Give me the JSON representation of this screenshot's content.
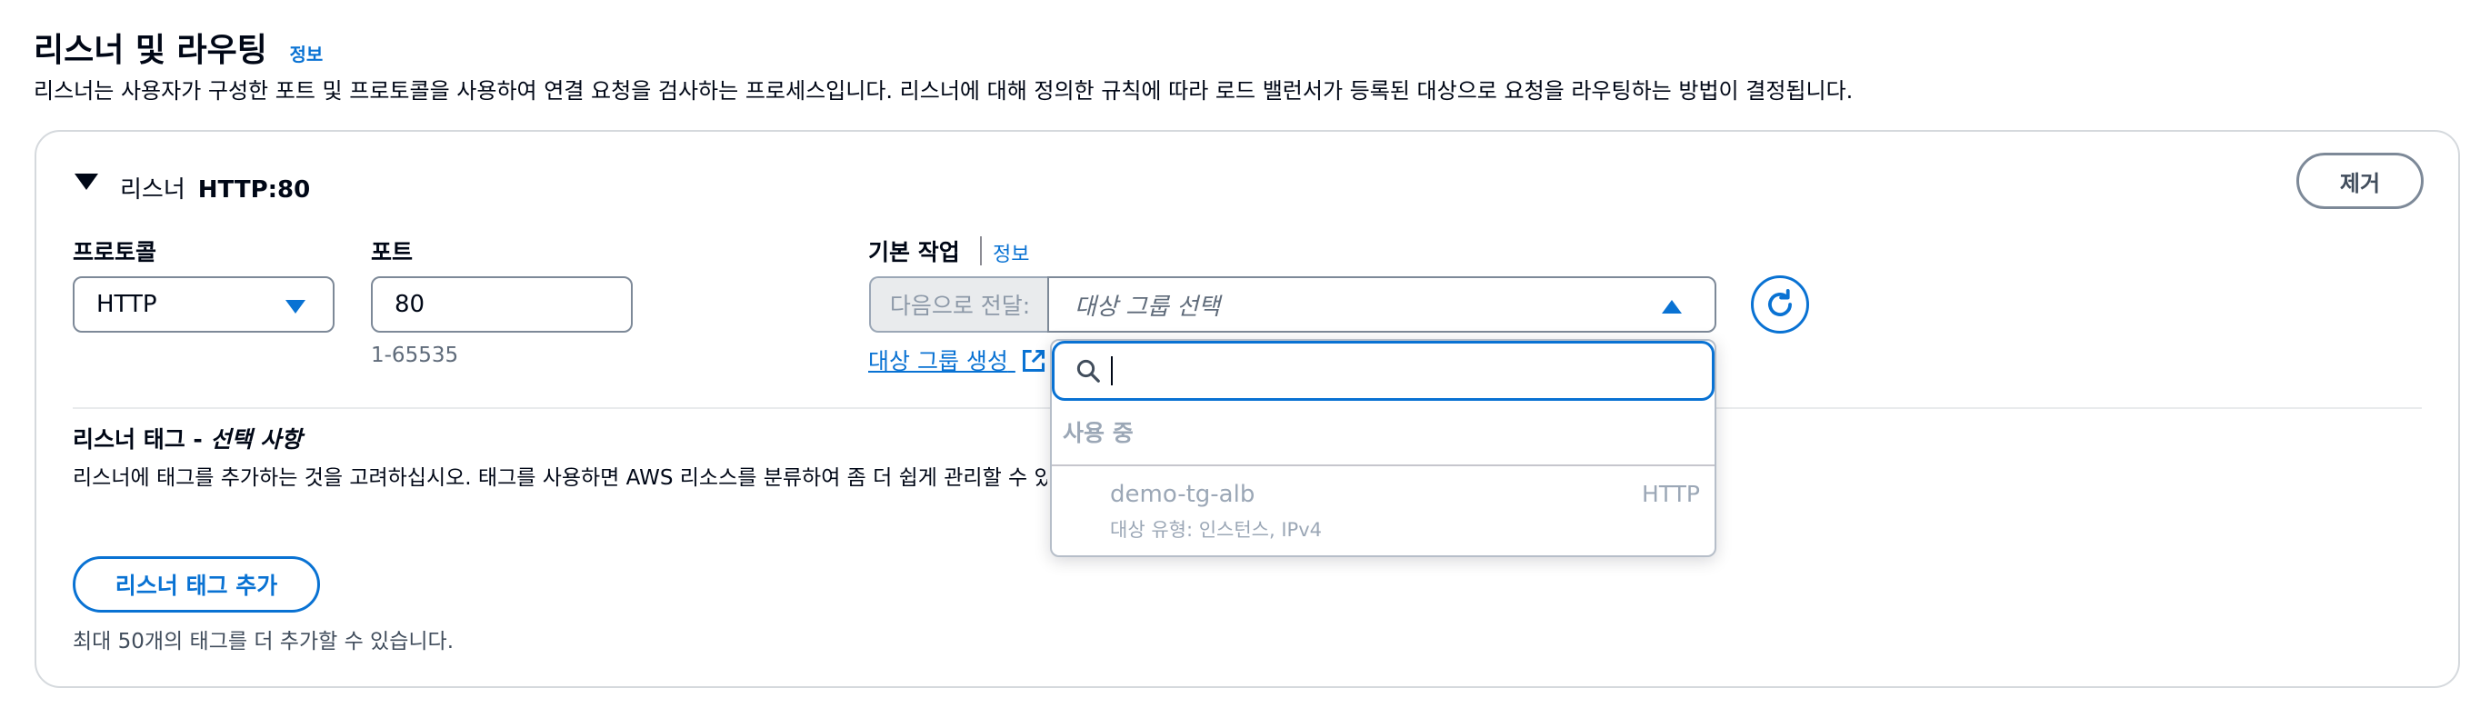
{
  "section": {
    "title": "리스너 및 라우팅",
    "info_label": "정보",
    "description": "리스너는 사용자가 구성한 포트 및 프로토콜을 사용하여 연결 요청을 검사하는 프로세스입니다. 리스너에 대해 정의한 규칙에 따라 로드 밸런서가 등록된 대상으로 요청을 라우팅하는 방법이 결정됩니다."
  },
  "listener": {
    "prefix": "리스너",
    "name": "HTTP:80",
    "remove_label": "제거",
    "protocol_label": "프로토콜",
    "protocol_value": "HTTP",
    "port_label": "포트",
    "port_value": "80",
    "port_hint": "1-65535",
    "default_action_label": "기본 작업",
    "default_action_info": "정보",
    "forward_prefix": "다음으로 전달:",
    "target_group_placeholder": "대상 그룹 선택",
    "create_target_group_link": "대상 그룹 생성"
  },
  "dropdown": {
    "search_value": "",
    "group_label": "사용 중",
    "options": [
      {
        "name": "demo-tg-alb",
        "protocol": "HTTP",
        "detail": "대상 유형: 인스턴스, IPv4"
      }
    ]
  },
  "tags": {
    "title_main": "리스너 태그 - ",
    "title_optional": "선택 사항",
    "description": "리스너에 태그를 추가하는 것을 고려하십시오. 태그를 사용하면 AWS 리소스를 분류하여 좀 더 쉽게 관리할 수 있습니다.",
    "add_button": "리스너 태그 추가",
    "limit_hint": "최대 50개의 태그를 더 추가할 수 있습니다."
  },
  "colors": {
    "link": "#0972d3",
    "text": "#000716",
    "border": "#7d8998"
  }
}
